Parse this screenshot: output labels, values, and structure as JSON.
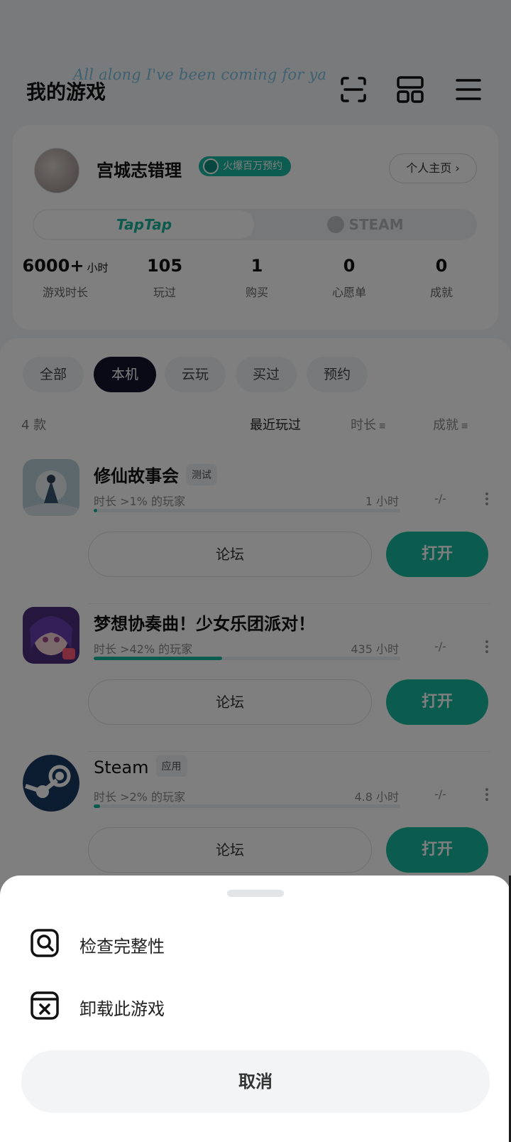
{
  "header": {
    "title": "我的游戏",
    "floating_lyric": "All along I've been coming for ya",
    "icons": [
      "scan-icon",
      "grid-layout-icon",
      "menu-icon"
    ]
  },
  "profile": {
    "username": "宫城志错理",
    "badge": "火爆百万预约",
    "profile_link": "个人主页 ›",
    "platform_tabs": [
      "TapTap",
      "STEAM"
    ],
    "active_platform": "TapTap",
    "stats": [
      {
        "value": "6000+",
        "unit": "小时",
        "label": "游戏时长"
      },
      {
        "value": "105",
        "unit": "",
        "label": "玩过"
      },
      {
        "value": "1",
        "unit": "",
        "label": "购买"
      },
      {
        "value": "0",
        "unit": "",
        "label": "心愿单"
      },
      {
        "value": "0",
        "unit": "",
        "label": "成就"
      }
    ]
  },
  "filters": {
    "chips": [
      "全部",
      "本机",
      "云玩",
      "买过",
      "预约"
    ],
    "active": "本机"
  },
  "list": {
    "count": "4 款",
    "sort": {
      "recent": "最近玩过",
      "duration": "时长",
      "achievement": "成就"
    },
    "sort_glyph": "≡"
  },
  "games": [
    {
      "name": "修仙故事会",
      "tag": "测试",
      "percentile": "时长 >1% 的玩家",
      "hours": "1 小时",
      "achievement": "-/-",
      "progress": 0.01,
      "forum": "论坛",
      "open": "打开",
      "icon_color": "#a9c4cf"
    },
    {
      "name": "梦想协奏曲！少女乐团派对！",
      "tag": "",
      "percentile": "时长 >42% 的玩家",
      "hours": "435 小时",
      "achievement": "-/-",
      "progress": 0.42,
      "forum": "论坛",
      "open": "打开",
      "icon_color": "#7a4fb0"
    },
    {
      "name": "Steam",
      "tag": "应用",
      "percentile": "时长 >2% 的玩家",
      "hours": "4.8 小时",
      "achievement": "-/-",
      "progress": 0.02,
      "forum": "论坛",
      "open": "打开",
      "icon_color": "#1b3a63"
    }
  ],
  "sheet": {
    "items": [
      {
        "label": "检查完整性",
        "icon": "search-check-icon"
      },
      {
        "label": "卸载此游戏",
        "icon": "uninstall-icon"
      }
    ],
    "cancel": "取消"
  },
  "colors": {
    "accent": "#17b69e",
    "active_chip": "#15142f",
    "overlay": "rgba(0,0,0,0.5)"
  }
}
